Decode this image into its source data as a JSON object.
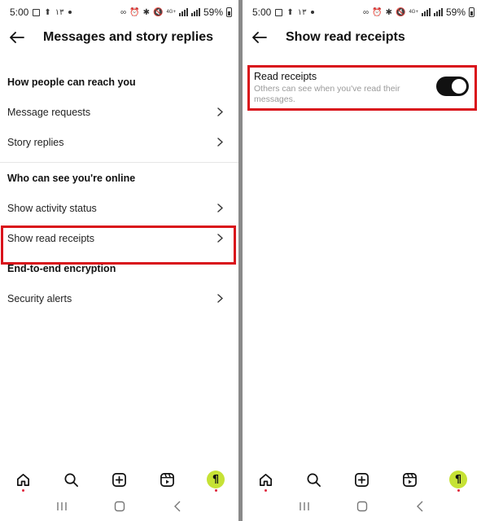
{
  "status_bar": {
    "time": "5:00",
    "arabic_digits": "۱۳",
    "network_label": "4G+",
    "battery_percent": "59%"
  },
  "left_screen": {
    "title": "Messages and story replies",
    "sections": [
      {
        "heading": "How people can reach you",
        "items": [
          "Message requests",
          "Story replies"
        ]
      },
      {
        "heading": "Who can see you're online",
        "items": [
          "Show activity status",
          "Show read receipts"
        ]
      },
      {
        "heading": "End-to-end encryption",
        "items": [
          "Security alerts"
        ]
      }
    ],
    "highlighted_item": "Show read receipts"
  },
  "right_screen": {
    "title": "Show read receipts",
    "setting": {
      "label": "Read receipts",
      "description": "Others can see when you've read their messages.",
      "enabled": true
    }
  },
  "bottom_nav": {
    "icons": [
      "home-icon",
      "search-icon",
      "create-icon",
      "reels-icon",
      "profile-avatar"
    ],
    "avatar_glyph": "¶"
  },
  "colors": {
    "highlight": "#d9121b",
    "toggle_on": "#111111",
    "avatar_bg": "#c6e235",
    "notification_dot": "#e0243b"
  }
}
